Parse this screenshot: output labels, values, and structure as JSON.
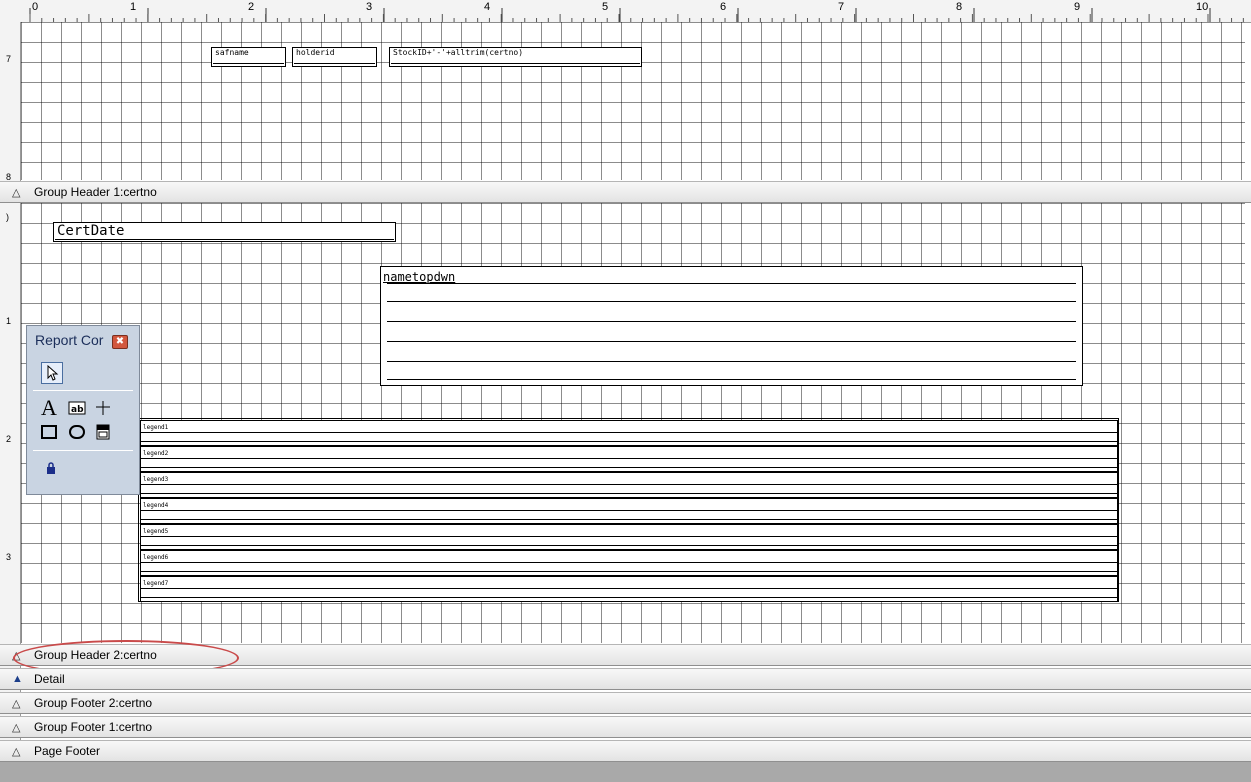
{
  "ruler": {
    "numbers": [
      "0",
      "1",
      "2",
      "3",
      "4",
      "5",
      "6",
      "7",
      "8",
      "9",
      "10"
    ],
    "side_marks": [
      "7",
      "8",
      ")",
      "1",
      "2",
      "3"
    ]
  },
  "bands": {
    "group_header_1": "Group Header 1:certno",
    "group_header_2": "Group Header 2:certno",
    "detail": "Detail",
    "group_footer_2": "Group Footer 2:certno",
    "group_footer_1": "Group Footer 1:certno",
    "page_footer": "Page Footer"
  },
  "fields": {
    "safname": "safname",
    "holderid": "holderid",
    "stockid_expr": "StockID+'-'+alltrim(certno)",
    "certdate": "CertDate",
    "nametopdwn": "nametopdwn"
  },
  "legends": [
    "legend1",
    "legend2",
    "legend3",
    "legend4",
    "legend5",
    "legend6",
    "legend7"
  ],
  "toolbox": {
    "title": "Report Cor",
    "close_glyph": "✖",
    "tools": {
      "pointer": "pointer-icon",
      "label": "label-icon",
      "field": "field-icon",
      "line": "line-icon",
      "rectangle": "rectangle-icon",
      "rounded_rect": "rounded-rectangle-icon",
      "picture": "picture-ole-icon",
      "lock": "lock-icon"
    }
  },
  "colors": {
    "highlight_oval": "#c94a4a",
    "toolbox_bg": "#c9d4e2",
    "band_bg": "#e8e8e8"
  }
}
